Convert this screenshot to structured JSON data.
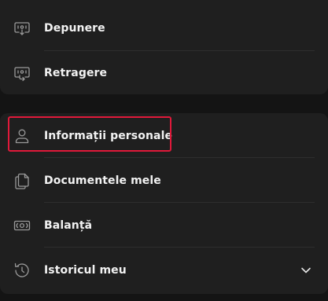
{
  "menu_top": {
    "items": [
      {
        "label": "Depunere",
        "icon": "deposit-icon"
      },
      {
        "label": "Retragere",
        "icon": "withdraw-icon"
      }
    ]
  },
  "menu_bottom": {
    "items": [
      {
        "label": "Informații personale",
        "icon": "user-icon",
        "highlighted": true
      },
      {
        "label": "Documentele mele",
        "icon": "documents-icon"
      },
      {
        "label": "Balanță",
        "icon": "balance-icon"
      },
      {
        "label": "Istoricul meu",
        "icon": "history-icon",
        "expandable": true
      }
    ]
  },
  "colors": {
    "background": "#141414",
    "card": "#1f1f1f",
    "text": "#f2f2f2",
    "icon": "#9a9a9a",
    "highlight": "#e0193a"
  }
}
